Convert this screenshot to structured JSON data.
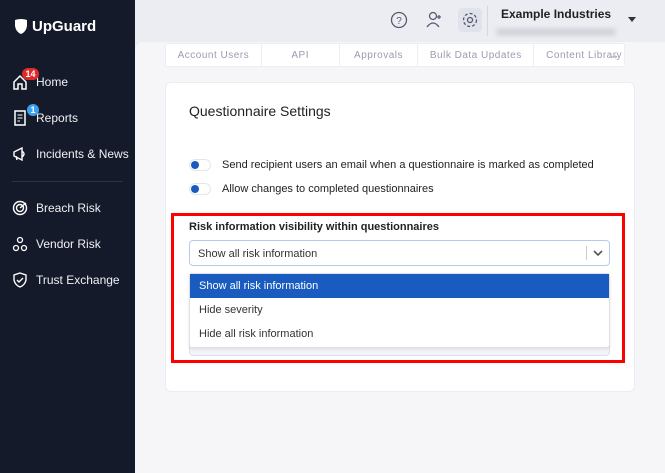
{
  "sidebar": {
    "logo": "UpGuard",
    "items": [
      {
        "label": "Home",
        "icon": "home-icon",
        "badge": "14"
      },
      {
        "label": "Reports",
        "icon": "report-icon",
        "badge": "1"
      },
      {
        "label": "Incidents & News",
        "icon": "megaphone-icon"
      },
      {
        "label": "Breach Risk",
        "icon": "radar-icon"
      },
      {
        "label": "Vendor Risk",
        "icon": "vendor-network-icon"
      },
      {
        "label": "Trust Exchange",
        "icon": "shield-check-icon"
      }
    ]
  },
  "header": {
    "org_name": "Example Industries",
    "icons": [
      "help-icon",
      "add-user-icon",
      "gear-icon"
    ]
  },
  "tabs": [
    "Account Users",
    "API",
    "Approvals",
    "Bulk Data Updates",
    "Content Library"
  ],
  "card": {
    "title": "Questionnaire Settings",
    "toggles": [
      {
        "label": "Send recipient users an email when a questionnaire is marked as completed"
      },
      {
        "label": "Allow changes to completed questionnaires"
      }
    ],
    "visibility_label": "Risk information visibility within questionnaires",
    "select_value": "Show all risk information",
    "options": [
      "Show all risk information",
      "Hide severity",
      "Hide all risk information"
    ]
  },
  "colors": {
    "accent": "#1a5bbf",
    "sidebar": "#151a2a",
    "highlight": "#ff0000",
    "badge_red": "#e02a2a",
    "badge_blue": "#3aa0f0"
  }
}
